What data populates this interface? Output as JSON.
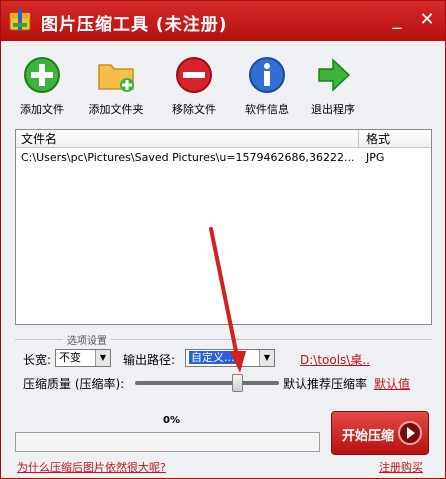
{
  "window": {
    "title": "图片压缩工具 (未注册)"
  },
  "titlebar": {
    "minimize": "_",
    "close": "✕"
  },
  "toolbar": [
    {
      "label": "添加文件",
      "icon": "add-file-icon"
    },
    {
      "label": "添加文件夹",
      "icon": "add-folder-icon"
    },
    {
      "label": "移除文件",
      "icon": "remove-file-icon"
    },
    {
      "label": "软件信息",
      "icon": "info-icon"
    },
    {
      "label": "退出程序",
      "icon": "exit-icon"
    }
  ],
  "filelist": {
    "columns": [
      "文件名",
      "格式"
    ],
    "rows": [
      {
        "name": "C:\\Users\\pc\\Pictures\\Saved Pictures\\u=1579462686,36222...",
        "format": "JPG"
      }
    ]
  },
  "options": {
    "legend": "选项设置",
    "size_label": "长宽:",
    "size_value": "不变",
    "output_label": "输出路径:",
    "output_value": "自定义...",
    "output_path": "D:\\tools\\桌..",
    "quality_label": "压缩质量 (压缩率):",
    "quality_hint": "默认推荐压缩率",
    "default_link": "默认值",
    "quality_level": 0.73
  },
  "progress": {
    "percent_text": "0%",
    "value": 0
  },
  "start_button": "开始压缩",
  "footer": {
    "help_link": "为什么压缩后图片依然很大呢?",
    "register_link": "注册购买"
  },
  "colors": {
    "brand_red": "#c81c1b",
    "link_red": "#c0141b",
    "selection_blue": "#2b5fd8"
  }
}
